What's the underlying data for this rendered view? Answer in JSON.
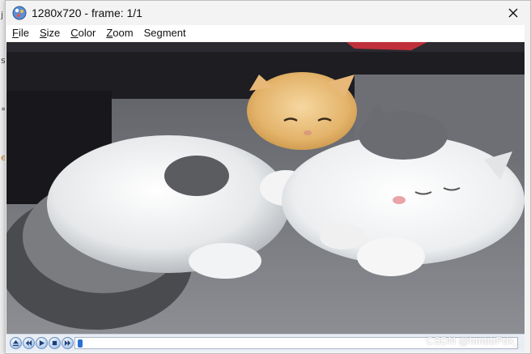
{
  "window": {
    "title": "1280x720 - frame: 1/1"
  },
  "menu": [
    {
      "mnemonic": "F",
      "rest": "ile"
    },
    {
      "mnemonic": "S",
      "rest": "ize"
    },
    {
      "mnemonic": "C",
      "rest": "olor"
    },
    {
      "mnemonic": "Z",
      "rest": "oom"
    },
    {
      "mnemonic": "",
      "rest": "Segment"
    }
  ],
  "playback": {
    "position_fraction": 0.0
  },
  "background_text": {
    "fragments": [
      "j",
      "s",
      "=",
      "e"
    ]
  },
  "watermark": "CSDN @hmbbPdx_",
  "colors": {
    "seek_thumb": "#2a6fd1",
    "control_bar": "#e9eef5"
  }
}
